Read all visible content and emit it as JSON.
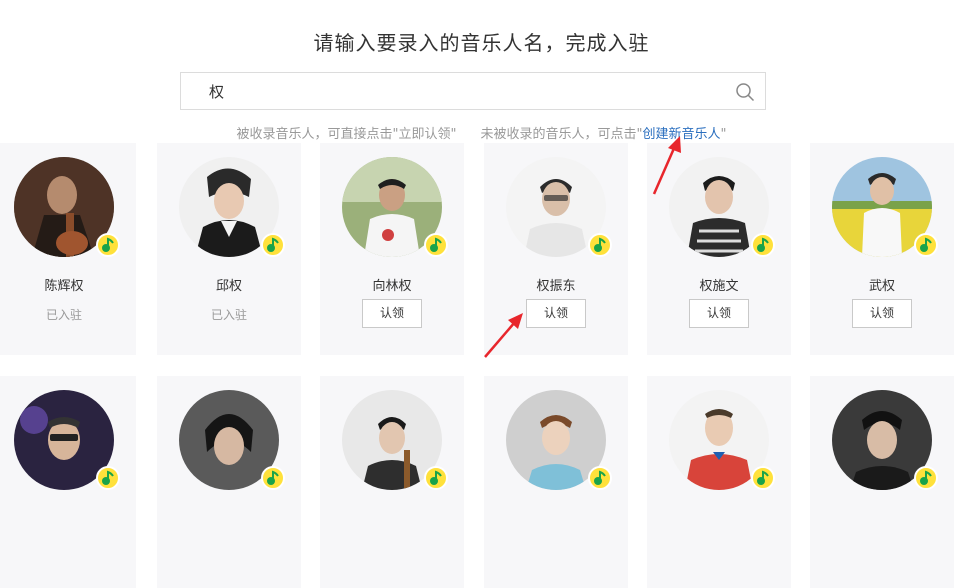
{
  "heading": "请输入要录入的音乐人名，完成入驻",
  "search": {
    "value": "权",
    "icon": "search-icon"
  },
  "hint": {
    "left": "被收录音乐人，可直接点击\"立即认领\"",
    "right": "未被收录的音乐人，可点击\"",
    "link": "创建新音乐人",
    "end": "\""
  },
  "artists": [
    {
      "name": "陈辉权",
      "status": "已入驻",
      "claimed": true
    },
    {
      "name": "邱权",
      "status": "已入驻",
      "claimed": true
    },
    {
      "name": "向林权",
      "button": "认领",
      "claimed": false
    },
    {
      "name": "权振东",
      "button": "认领",
      "claimed": false
    },
    {
      "name": "权施文",
      "button": "认领",
      "claimed": false
    },
    {
      "name": "武权",
      "button": "认领",
      "claimed": false
    }
  ],
  "colors": {
    "accent_link": "#2b6fbf",
    "badge": "#ffe13b",
    "annotation_arrow": "#e8262c"
  }
}
